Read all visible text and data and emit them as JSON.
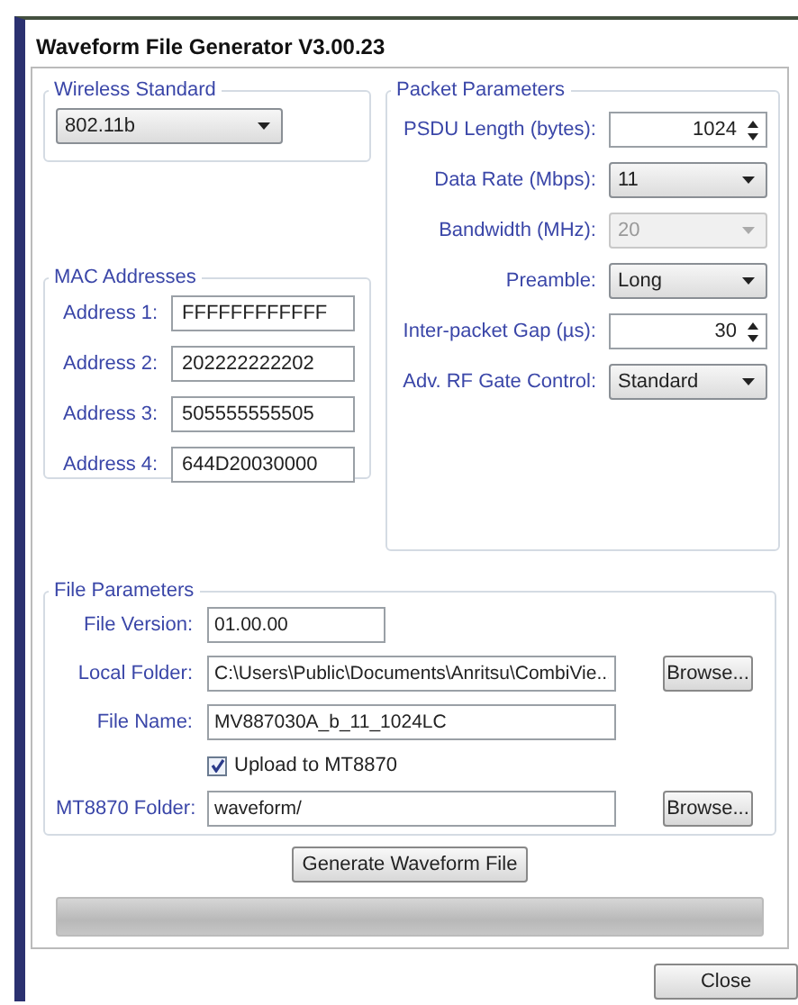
{
  "window": {
    "title": "Waveform File Generator  V3.00.23"
  },
  "wireless_standard": {
    "title": "Wireless Standard",
    "value": "802.11b"
  },
  "mac_addresses": {
    "title": "MAC Addresses",
    "fields": [
      {
        "label": "Address 1:",
        "value": "FFFFFFFFFFFF"
      },
      {
        "label": "Address 2:",
        "value": "202222222202"
      },
      {
        "label": "Address 3:",
        "value": "505555555505"
      },
      {
        "label": "Address 4:",
        "value": "644D20030000"
      }
    ]
  },
  "packet_parameters": {
    "title": "Packet Parameters",
    "fields": [
      {
        "label": "PSDU Length (bytes):",
        "kind": "spinner",
        "value": "1024",
        "disabled": false
      },
      {
        "label": "Data Rate (Mbps):",
        "kind": "dropdown",
        "value": "11",
        "disabled": false
      },
      {
        "label": "Bandwidth (MHz):",
        "kind": "dropdown",
        "value": "20",
        "disabled": true
      },
      {
        "label": "Preamble:",
        "kind": "dropdown",
        "value": "Long",
        "disabled": false
      },
      {
        "label": "Inter-packet Gap (µs):",
        "kind": "spinner",
        "value": "30",
        "disabled": false
      },
      {
        "label": "Adv. RF Gate Control:",
        "kind": "dropdown",
        "value": "Standard",
        "disabled": false
      }
    ]
  },
  "file_parameters": {
    "title": "File Parameters",
    "rows": [
      {
        "kind": "text",
        "label": "File Version:",
        "value": "01.00.00"
      },
      {
        "kind": "text",
        "label": "Local Folder:",
        "value": "C:\\Users\\Public\\Documents\\Anritsu\\CombiVie...",
        "button": "Browse..."
      },
      {
        "kind": "text",
        "label": "File Name:",
        "value": "MV887030A_b_11_1024LC"
      },
      {
        "kind": "checkbox",
        "label": "Upload to MT8870",
        "checked": true
      },
      {
        "kind": "text",
        "label": "MT8870 Folder:",
        "value": "waveform/",
        "button": "Browse..."
      }
    ]
  },
  "generate_button": "Generate Waveform File",
  "progress_bar": {
    "level": 0
  },
  "close_button": "Close"
}
